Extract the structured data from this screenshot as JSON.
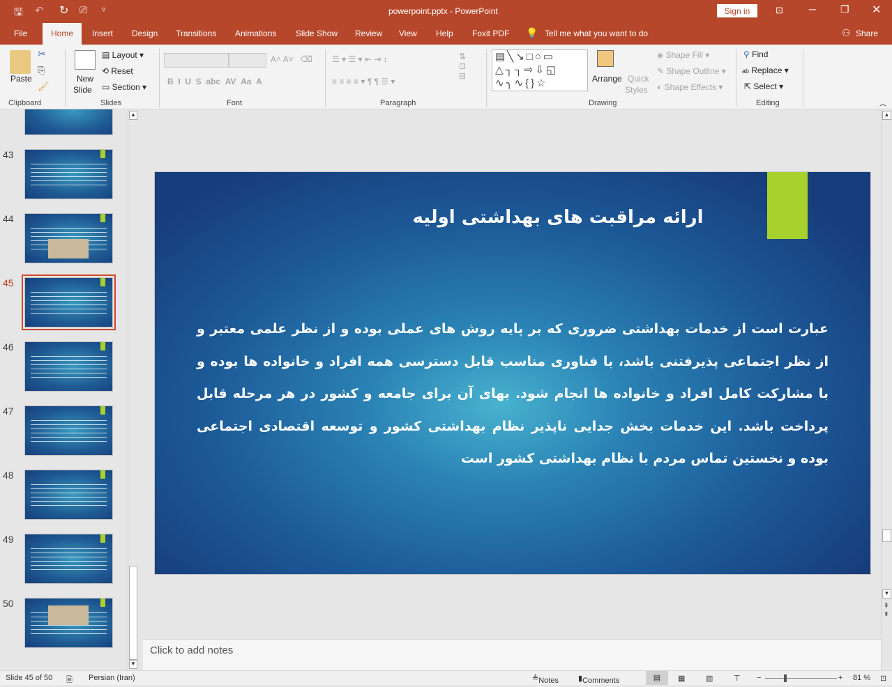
{
  "titlebar": {
    "title": "powerpoint.pptx  -  PowerPoint",
    "sign_in": "Sign in"
  },
  "tabs": [
    "File",
    "Home",
    "Insert",
    "Design",
    "Transitions",
    "Animations",
    "Slide Show",
    "Review",
    "View",
    "Help",
    "Foxit PDF"
  ],
  "tell_me": "Tell me what you want to do",
  "share": "Share",
  "ribbon": {
    "clipboard": {
      "paste": "Paste",
      "label": "Clipboard"
    },
    "slides": {
      "new_slide": "New",
      "new_slide2": "Slide",
      "layout": "Layout",
      "reset": "Reset",
      "section": "Section",
      "label": "Slides"
    },
    "font": {
      "label": "Font"
    },
    "paragraph": {
      "label": "Paragraph"
    },
    "drawing": {
      "arrange": "Arrange",
      "quick_styles": "Quick",
      "quick_styles2": "Styles",
      "shape_fill": "Shape Fill",
      "shape_outline": "Shape Outline",
      "shape_effects": "Shape Effects",
      "label": "Drawing"
    },
    "editing": {
      "find": "Find",
      "replace": "Replace",
      "select": "Select",
      "label": "Editing"
    }
  },
  "thumbnails": {
    "numbers": [
      "43",
      "44",
      "45",
      "46",
      "47",
      "48",
      "49",
      "50"
    ],
    "selected": "45"
  },
  "slide": {
    "title": "ارائه مراقبت های بهداشتی اولیه",
    "body": "عبارت است از خدمات بهداشتی ضروری که بر پایه روش های عملی بوده و از نظر علمی معتبر و از نظر اجتماعی پذیرفتنی باشد، با فناوری مناسب قابل دسترسی همه افراد و خانواده ها بوده و با مشارکت کامل افراد و خانواده ها انجام شود. بهای آن برای جامعه و کشور در هر مرحله قابل پرداخت باشد. این خدمات بخش جدایی ناپذیر نظام بهداشتی کشور و توسعه اقتصادی اجتماعی بوده و نخستین تماس مردم با نظام بهداشتی کشور است",
    "accent": "#a8d12c"
  },
  "notes_placeholder": "Click to add notes",
  "status": {
    "slide": "Slide 45 of 50",
    "language": "Persian (Iran)",
    "notes": "Notes",
    "comments": "Comments",
    "zoom": "81 %",
    "zoom_level": 81
  }
}
